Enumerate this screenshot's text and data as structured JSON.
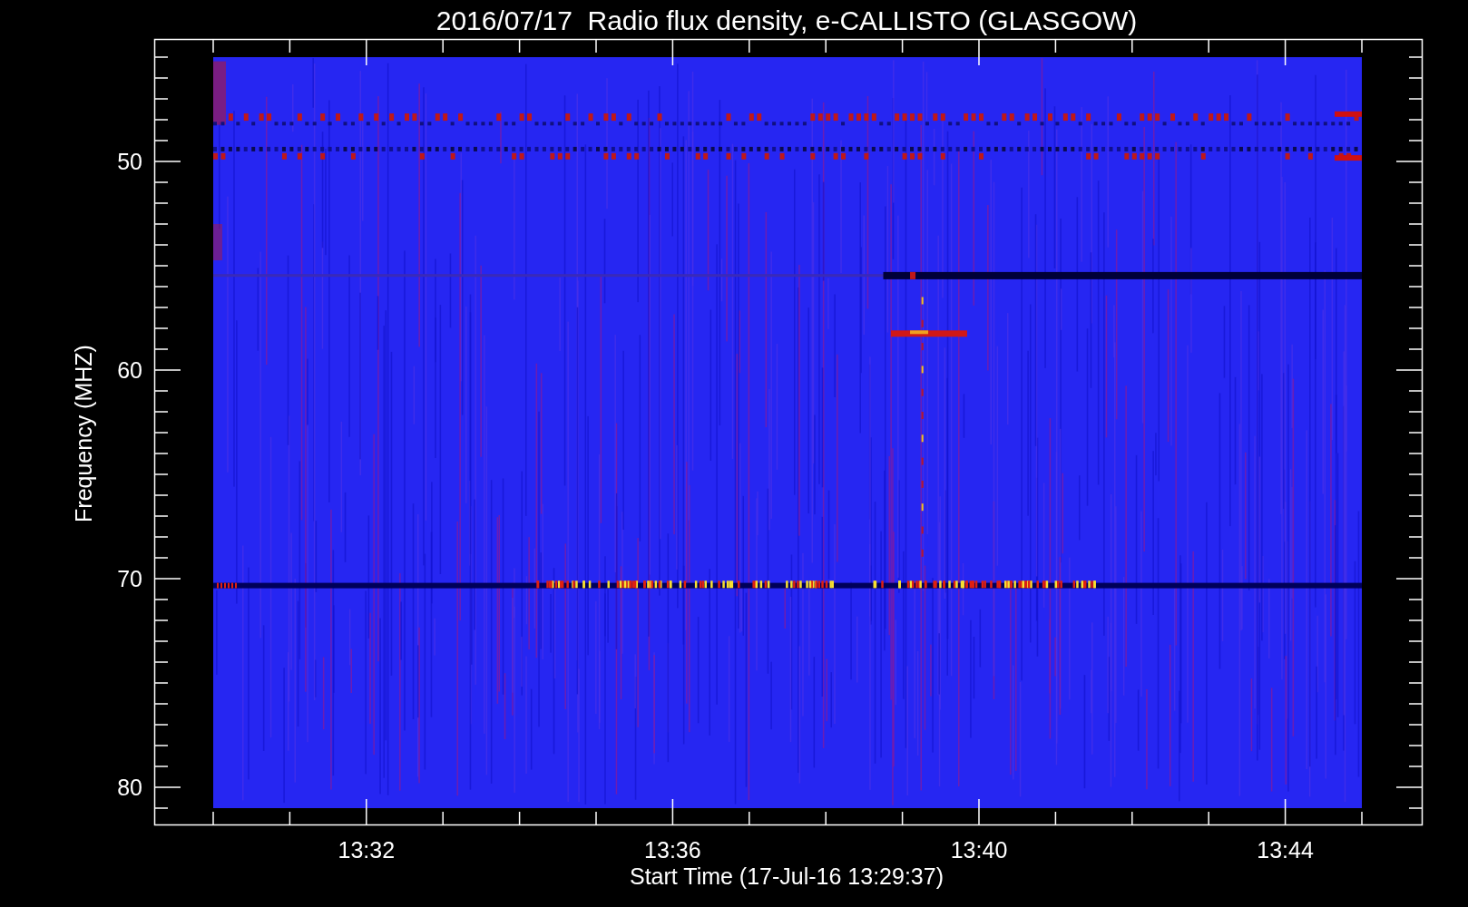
{
  "title": "2016/07/17  Radio flux density, e-CALLISTO (GLASGOW)",
  "xlabel": "Start Time (17-Jul-16 13:29:37)",
  "ylabel": "Frequency (MHZ)",
  "xticks": [
    "13:32",
    "13:36",
    "13:40",
    "13:44"
  ],
  "yticks": [
    "50",
    "60",
    "70",
    "80"
  ]
}
